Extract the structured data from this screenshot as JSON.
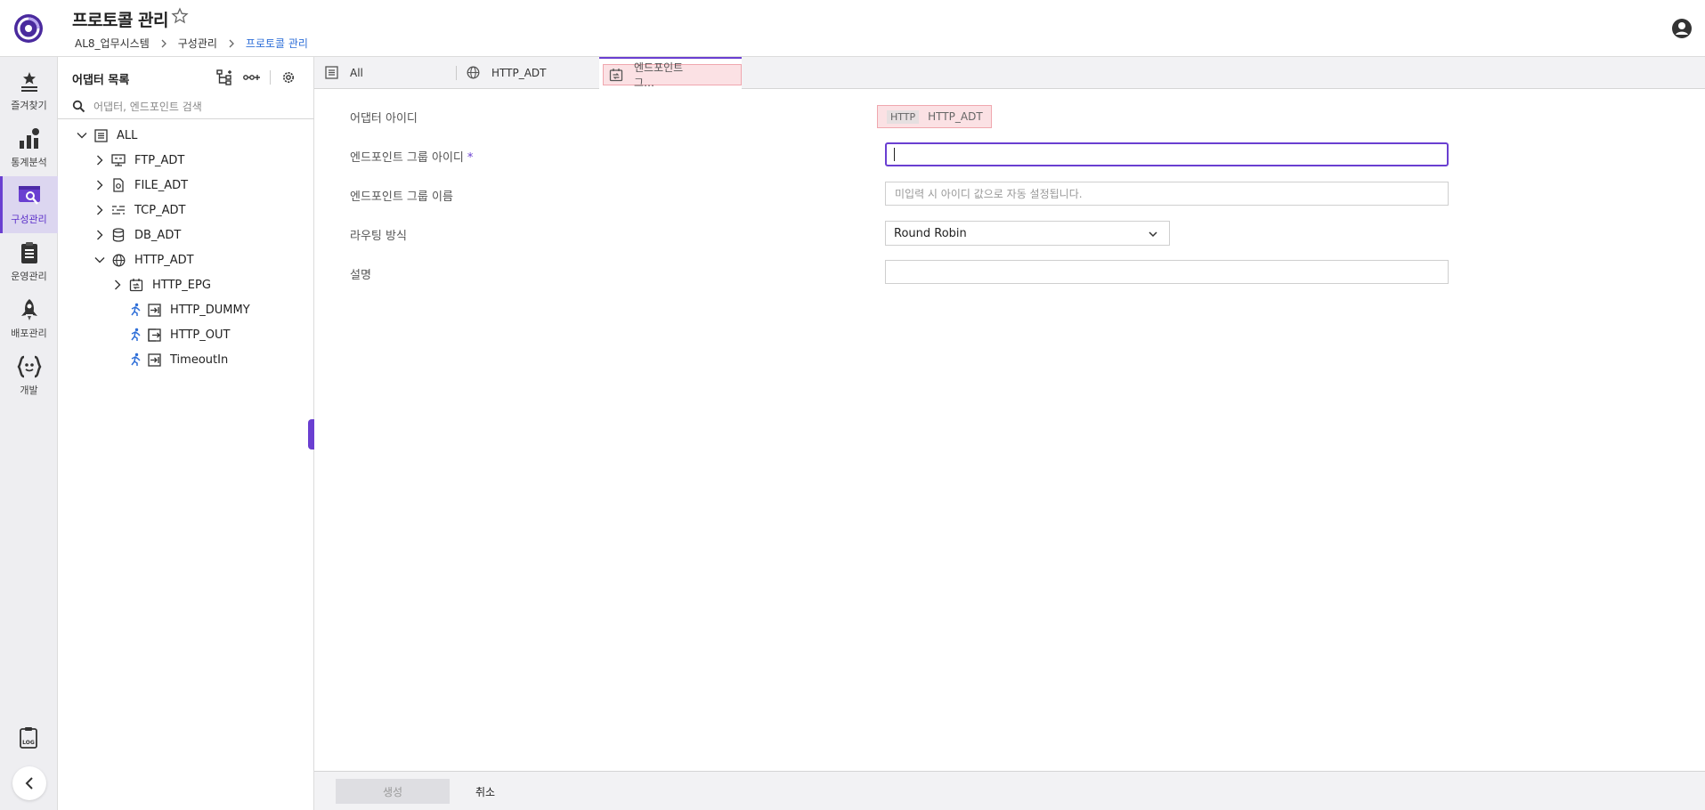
{
  "header": {
    "title": "프로토콜 관리",
    "breadcrumb": [
      "AL8_업무시스템",
      "구성관리",
      "프로토콜 관리"
    ]
  },
  "rail": {
    "items": [
      {
        "label": "즐겨찾기",
        "icon": "star-list-icon"
      },
      {
        "label": "통계분석",
        "icon": "chart-icon"
      },
      {
        "label": "구성관리",
        "icon": "config-icon",
        "active": true
      },
      {
        "label": "운영관리",
        "icon": "clipboard-icon"
      },
      {
        "label": "배포관리",
        "icon": "rocket-icon"
      },
      {
        "label": "개발",
        "icon": "code-braces-icon"
      }
    ]
  },
  "panel": {
    "title": "어댑터 목록",
    "search_placeholder": "어댑터, 엔드포인트 검색",
    "tree": [
      {
        "label": "ALL",
        "icon": "list-icon",
        "expanded": true
      },
      {
        "label": "FTP_ADT",
        "icon": "ftp-icon"
      },
      {
        "label": "FILE_ADT",
        "icon": "file-icon"
      },
      {
        "label": "TCP_ADT",
        "icon": "tcp-icon"
      },
      {
        "label": "DB_ADT",
        "icon": "database-icon"
      },
      {
        "label": "HTTP_ADT",
        "icon": "globe-icon",
        "expanded": true
      },
      {
        "label": "HTTP_EPG",
        "icon": "endpoint-group-icon"
      },
      {
        "label": "HTTP_DUMMY",
        "icon": "endpoint-in-icon"
      },
      {
        "label": "HTTP_OUT",
        "icon": "endpoint-out-icon"
      },
      {
        "label": "TimeoutIn",
        "icon": "endpoint-in-icon"
      }
    ]
  },
  "tabs": [
    {
      "label": "All",
      "icon": "list-icon"
    },
    {
      "label": "HTTP_ADT",
      "icon": "globe-icon"
    },
    {
      "label": "엔드포인트 그…",
      "icon": "endpoint-group-icon",
      "active": true
    }
  ],
  "form": {
    "adapter_id_label": "어댑터 아이디",
    "adapter_tag": "HTTP",
    "adapter_id_value": "HTTP_ADT",
    "group_id_label": "엔드포인트 그룹 아이디",
    "required_mark": "*",
    "group_id_value": "",
    "group_name_label": "엔드포인트 그룹 이름",
    "group_name_placeholder": "미입력 시 아이디 값으로 자동 설정됩니다.",
    "routing_label": "라우팅 방식",
    "routing_value": "Round Robin",
    "description_label": "설명",
    "description_value": ""
  },
  "actions": {
    "create_label": "생성",
    "cancel_label": "취소"
  },
  "colors": {
    "accent": "#6a3fd1",
    "link": "#2f6fd8",
    "highlight_bg": "#fbe1e4",
    "highlight_border": "#f0a7ae"
  }
}
